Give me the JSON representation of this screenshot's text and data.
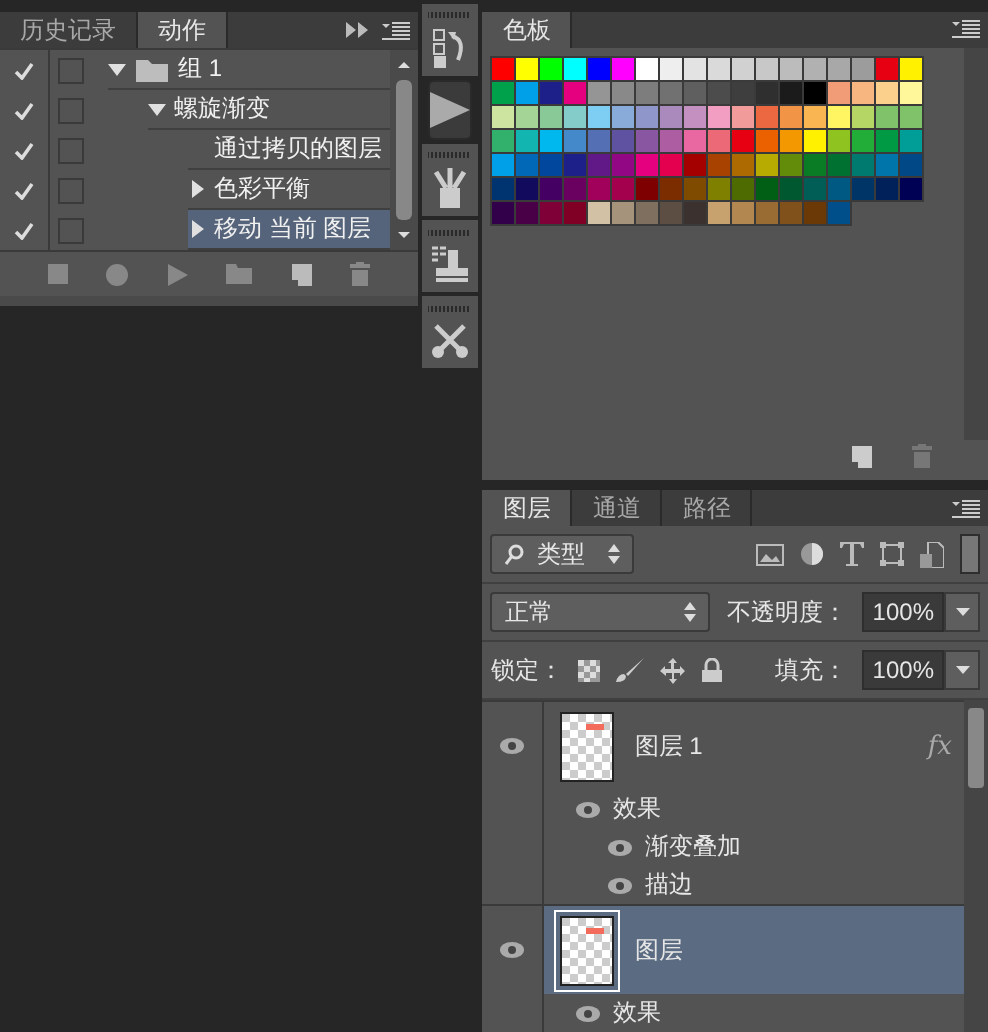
{
  "actions_panel": {
    "tabs": [
      {
        "label": "历史记录",
        "selected": false
      },
      {
        "label": "动作",
        "selected": true
      }
    ],
    "items": [
      {
        "label": "组 1",
        "folder": true,
        "checked": true,
        "expanded": true,
        "selected": false,
        "children": [
          {
            "label": "螺旋渐变",
            "checked": true,
            "expanded": true,
            "selected": false,
            "children": [
              {
                "label": "通过拷贝的图层",
                "checked": true,
                "selected": false
              },
              {
                "label": "色彩平衡",
                "checked": true,
                "expanded": false,
                "selected": false
              },
              {
                "label": "移动 当前 图层",
                "checked": true,
                "expanded": false,
                "selected": true
              }
            ]
          }
        ]
      }
    ],
    "footer": [
      {
        "kind": "stop"
      },
      {
        "kind": "record"
      },
      {
        "kind": "play"
      },
      {
        "kind": "folder"
      },
      {
        "kind": "new"
      },
      {
        "kind": "trash"
      }
    ]
  },
  "toolstrip": [
    {
      "kind": "history",
      "selected": false
    },
    {
      "kind": "play",
      "selected": true
    },
    {
      "kind": "brushes",
      "selected": false
    },
    {
      "kind": "stamp",
      "selected": false
    },
    {
      "kind": "tools",
      "selected": false
    }
  ],
  "swatches_panel": {
    "tabs": [
      {
        "label": "色板",
        "selected": true
      }
    ],
    "rows": [
      {
        "swatches": [
          {
            "color": "#ff0000"
          },
          {
            "color": "#ffff00"
          },
          {
            "color": "#00ff00"
          },
          {
            "color": "#00ffff"
          },
          {
            "color": "#0000ff"
          },
          {
            "color": "#ff00ff"
          },
          {
            "color": "#ffffff"
          },
          {
            "color": "#eeeeee"
          },
          {
            "color": "#e3e3e3"
          },
          {
            "color": "#dadada"
          },
          {
            "color": "#d1d1d1"
          },
          {
            "color": "#c8c8c8"
          },
          {
            "color": "#bcbcbc"
          },
          {
            "color": "#b1b1b1"
          },
          {
            "color": "#a8a8a8"
          },
          {
            "color": "#9c9c9c"
          },
          {
            "color": "#e60012"
          },
          {
            "color": "#fff100"
          }
        ]
      },
      {
        "swatches": [
          {
            "color": "#00a14b"
          },
          {
            "color": "#00a0e9"
          },
          {
            "color": "#1d2088"
          },
          {
            "color": "#e4007f"
          },
          {
            "color": "#959595"
          },
          {
            "color": "#898989"
          },
          {
            "color": "#7d7d7d"
          },
          {
            "color": "#717171"
          },
          {
            "color": "#5f5f5f"
          },
          {
            "color": "#4c4c4c"
          },
          {
            "color": "#3e3e3e"
          },
          {
            "color": "#2f2f2f"
          },
          {
            "color": "#1b1b1b"
          },
          {
            "color": "#000000"
          },
          {
            "color": "#f19b77"
          },
          {
            "color": "#f7b67f"
          },
          {
            "color": "#fbd08c"
          },
          {
            "color": "#fff799"
          }
        ]
      },
      {
        "swatches": [
          {
            "color": "#cde3a0"
          },
          {
            "color": "#a5d497"
          },
          {
            "color": "#89c997"
          },
          {
            "color": "#84ccc9"
          },
          {
            "color": "#7ecef4"
          },
          {
            "color": "#89abda"
          },
          {
            "color": "#8f96c9"
          },
          {
            "color": "#aa89bd"
          },
          {
            "color": "#c490bf"
          },
          {
            "color": "#f19ec2"
          },
          {
            "color": "#f29b9b"
          },
          {
            "color": "#eb6841"
          },
          {
            "color": "#f29446"
          },
          {
            "color": "#f8b551"
          },
          {
            "color": "#fff462"
          },
          {
            "color": "#b5d565"
          },
          {
            "color": "#80c269"
          },
          {
            "color": "#80c269"
          }
        ]
      },
      {
        "swatches": [
          {
            "color": "#32b16c"
          },
          {
            "color": "#13b5b1"
          },
          {
            "color": "#00b7ee"
          },
          {
            "color": "#448aca"
          },
          {
            "color": "#556fb5"
          },
          {
            "color": "#5f52a0"
          },
          {
            "color": "#8957a1"
          },
          {
            "color": "#ad5da1"
          },
          {
            "color": "#ea68a2"
          },
          {
            "color": "#ec6977"
          },
          {
            "color": "#e60012"
          },
          {
            "color": "#eb6100"
          },
          {
            "color": "#f39800"
          },
          {
            "color": "#fff100"
          },
          {
            "color": "#8fc31f"
          },
          {
            "color": "#22ac38"
          },
          {
            "color": "#009944"
          },
          {
            "color": "#009e96"
          }
        ]
      },
      {
        "swatches": [
          {
            "color": "#00a0e9"
          },
          {
            "color": "#0068b7"
          },
          {
            "color": "#00479d"
          },
          {
            "color": "#1d2088"
          },
          {
            "color": "#601986"
          },
          {
            "color": "#920783"
          },
          {
            "color": "#e4007f"
          },
          {
            "color": "#e5004f"
          },
          {
            "color": "#a40000"
          },
          {
            "color": "#a84200"
          },
          {
            "color": "#ac6a00"
          },
          {
            "color": "#b7aa00"
          },
          {
            "color": "#638c0b"
          },
          {
            "color": "#097c25"
          },
          {
            "color": "#007130"
          },
          {
            "color": "#007a6e"
          },
          {
            "color": "#0075a9"
          },
          {
            "color": "#004986"
          }
        ]
      },
      {
        "swatches": [
          {
            "color": "#003471"
          },
          {
            "color": "#120b5d"
          },
          {
            "color": "#440062"
          },
          {
            "color": "#6a005f"
          },
          {
            "color": "#a1005b"
          },
          {
            "color": "#a3004e"
          },
          {
            "color": "#7f0000"
          },
          {
            "color": "#7c2d00"
          },
          {
            "color": "#7f4b00"
          },
          {
            "color": "#808000"
          },
          {
            "color": "#4d6b00"
          },
          {
            "color": "#005e15"
          },
          {
            "color": "#005830"
          },
          {
            "color": "#005e56"
          },
          {
            "color": "#005982"
          },
          {
            "color": "#003567"
          },
          {
            "color": "#002159"
          },
          {
            "color": "#000054"
          }
        ]
      },
      {
        "swatches": [
          {
            "color": "#32004b"
          },
          {
            "color": "#4a0046"
          },
          {
            "color": "#7e0037"
          },
          {
            "color": "#7f0024"
          },
          {
            "color": "#d3c1a6"
          },
          {
            "color": "#a6937c"
          },
          {
            "color": "#7f6f5e"
          },
          {
            "color": "#5c4e43"
          },
          {
            "color": "#3b3230"
          },
          {
            "color": "#c7a26f"
          },
          {
            "color": "#b28850"
          },
          {
            "color": "#996c33"
          },
          {
            "color": "#81511c"
          },
          {
            "color": "#6a3906"
          },
          {
            "color": "#004f8b"
          }
        ]
      }
    ]
  },
  "layers_panel": {
    "tabs": [
      {
        "label": "图层",
        "selected": true
      },
      {
        "label": "通道",
        "selected": false
      },
      {
        "label": "路径",
        "selected": false
      }
    ],
    "filter": {
      "value": "类型"
    },
    "blend_mode": {
      "value": "正常"
    },
    "opacity": {
      "label": "不透明度：",
      "value": "100%"
    },
    "lock_label": "锁定：",
    "fill": {
      "label": "填充：",
      "value": "100%"
    },
    "layers": [
      {
        "name": "图层 1",
        "fx": "fx",
        "selected": false,
        "effects": [
          {
            "label": "效果",
            "children": [
              {
                "label": "渐变叠加"
              },
              {
                "label": "描边"
              }
            ]
          }
        ]
      },
      {
        "name": "图层",
        "selected": true,
        "effects": [
          {
            "label": "效果"
          }
        ]
      }
    ]
  }
}
